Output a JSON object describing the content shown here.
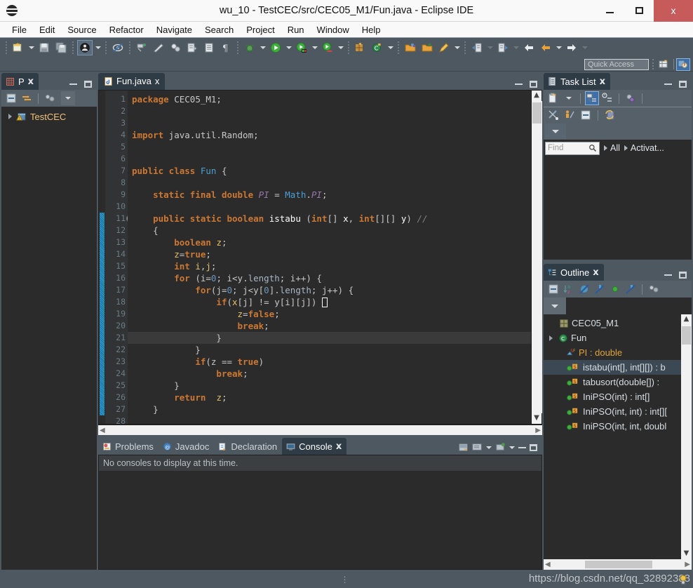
{
  "window": {
    "title": "wu_10 - TestCEC/src/CEC05_M1/Fun.java - Eclipse IDE",
    "minimize_label": "Minimize",
    "maximize_label": "Maximize",
    "close_label": "x"
  },
  "menubar": {
    "items": [
      "File",
      "Edit",
      "Source",
      "Refactor",
      "Navigate",
      "Search",
      "Project",
      "Run",
      "Window",
      "Help"
    ]
  },
  "toolbar": {
    "quick_access_placeholder": "Quick Access",
    "buttons": [
      "new-wizard-icon",
      "new-dropdown-icon",
      "save-icon",
      "save-all-icon",
      "skip-breakpoints-icon",
      "skip-dropdown-icon",
      "no-marker-icon",
      "toggle-mark-occurrences-icon",
      "annotate-icon",
      "link-icon",
      "open-type-icon",
      "open-task-icon",
      "pilcrow-icon",
      "debug-icon",
      "debug-dropdown-icon",
      "run-icon",
      "run-dropdown-icon",
      "run-as-icon",
      "run-as-dropdown-icon",
      "coverage-icon",
      "coverage-dropdown-icon",
      "new-java-project-icon",
      "new-class-icon",
      "new-class-dropdown-icon",
      "open-folder-icon",
      "open-folder2-icon",
      "edit-icon",
      "edit-dropdown-icon",
      "prev-annotation-icon",
      "prev-annotation-dropdown-icon",
      "next-annotation-icon",
      "next-annotation-dropdown-icon",
      "back-icon",
      "back-dropdown-icon",
      "forward-icon",
      "forward-dropdown-icon"
    ],
    "perspective_new_icon": "open-perspective-icon",
    "perspective_active_icon": "java-perspective-icon"
  },
  "package_explorer": {
    "tab_label": "P",
    "tab_icon": "package-explorer-icon",
    "close_label": "x",
    "toolbar": [
      "collapse-all-icon",
      "link-with-editor-icon",
      "view-menu-icon",
      "view-dropdown-icon"
    ],
    "tree": [
      {
        "label": "TestCEC",
        "icon": "java-project-warning-icon",
        "expandable": true
      }
    ]
  },
  "editor": {
    "tab_label": "Fun.java",
    "tab_icon": "java-file-icon",
    "close_label": "x",
    "current_line": 21,
    "fold_marker_line": 11,
    "change_bar_from": 11,
    "change_bar_to": 27,
    "lines": [
      {
        "n": 1,
        "tokens": [
          {
            "t": "package",
            "c": "kw"
          },
          {
            "t": " CEC05_M1;",
            "c": "plain"
          }
        ]
      },
      {
        "n": 2,
        "tokens": []
      },
      {
        "n": 3,
        "tokens": []
      },
      {
        "n": 4,
        "tokens": [
          {
            "t": "import",
            "c": "kw"
          },
          {
            "t": " java.util.Random;",
            "c": "plain"
          }
        ]
      },
      {
        "n": 5,
        "tokens": []
      },
      {
        "n": 6,
        "tokens": []
      },
      {
        "n": 7,
        "tokens": [
          {
            "t": "public class ",
            "c": "kw"
          },
          {
            "t": "Fun",
            "c": "typ"
          },
          {
            "t": " {",
            "c": "plain"
          }
        ]
      },
      {
        "n": 8,
        "tokens": []
      },
      {
        "n": 9,
        "tokens": [
          {
            "t": "    ",
            "c": "plain"
          },
          {
            "t": "static final double ",
            "c": "kw"
          },
          {
            "t": "PI",
            "c": "stat"
          },
          {
            "t": " = ",
            "c": "plain"
          },
          {
            "t": "Math",
            "c": "typ"
          },
          {
            "t": ".",
            "c": "plain"
          },
          {
            "t": "PI",
            "c": "stat"
          },
          {
            "t": ";",
            "c": "plain"
          }
        ]
      },
      {
        "n": 10,
        "tokens": []
      },
      {
        "n": 11,
        "tokens": [
          {
            "t": "    ",
            "c": "plain"
          },
          {
            "t": "public static boolean ",
            "c": "kw"
          },
          {
            "t": "istabu ",
            "c": "meth"
          },
          {
            "t": "(",
            "c": "plain"
          },
          {
            "t": "int",
            "c": "kw"
          },
          {
            "t": "[] ",
            "c": "plain"
          },
          {
            "t": "x",
            "c": "meth"
          },
          {
            "t": ", ",
            "c": "plain"
          },
          {
            "t": "int",
            "c": "kw"
          },
          {
            "t": "[][] ",
            "c": "plain"
          },
          {
            "t": "y",
            "c": "meth"
          },
          {
            "t": ") ",
            "c": "plain"
          },
          {
            "t": "//",
            "c": "cmt"
          }
        ]
      },
      {
        "n": 12,
        "tokens": [
          {
            "t": "    {",
            "c": "plain"
          }
        ]
      },
      {
        "n": 13,
        "tokens": [
          {
            "t": "        ",
            "c": "plain"
          },
          {
            "t": "boolean ",
            "c": "kw"
          },
          {
            "t": "z",
            "c": "var"
          },
          {
            "t": ";",
            "c": "plain"
          }
        ]
      },
      {
        "n": 14,
        "tokens": [
          {
            "t": "        ",
            "c": "plain"
          },
          {
            "t": "z",
            "c": "var"
          },
          {
            "t": "=",
            "c": "plain"
          },
          {
            "t": "true",
            "c": "kw"
          },
          {
            "t": ";",
            "c": "plain"
          }
        ]
      },
      {
        "n": 15,
        "tokens": [
          {
            "t": "        ",
            "c": "plain"
          },
          {
            "t": "int ",
            "c": "kw"
          },
          {
            "t": "i",
            "c": "var"
          },
          {
            "t": ",",
            "c": "plain"
          },
          {
            "t": "j",
            "c": "var"
          },
          {
            "t": ";",
            "c": "plain"
          }
        ]
      },
      {
        "n": 16,
        "tokens": [
          {
            "t": "        ",
            "c": "plain"
          },
          {
            "t": "for",
            "c": "kw"
          },
          {
            "t": " (i=",
            "c": "plain"
          },
          {
            "t": "0",
            "c": "num"
          },
          {
            "t": "; i<y.",
            "c": "plain"
          },
          {
            "t": "length",
            "c": "fld"
          },
          {
            "t": "; i++) {",
            "c": "plain"
          }
        ]
      },
      {
        "n": 17,
        "tokens": [
          {
            "t": "            ",
            "c": "plain"
          },
          {
            "t": "for",
            "c": "kw"
          },
          {
            "t": "(j=",
            "c": "plain"
          },
          {
            "t": "0",
            "c": "num"
          },
          {
            "t": "; j<y[",
            "c": "plain"
          },
          {
            "t": "0",
            "c": "num"
          },
          {
            "t": "].",
            "c": "plain"
          },
          {
            "t": "length",
            "c": "fld"
          },
          {
            "t": "; j++) {",
            "c": "plain"
          }
        ]
      },
      {
        "n": 18,
        "tokens": [
          {
            "t": "                ",
            "c": "plain"
          },
          {
            "t": "if",
            "c": "kw"
          },
          {
            "t": "(",
            "c": "plain"
          },
          {
            "t": "x",
            "c": "var"
          },
          {
            "t": "[j] != y[i][j]) ",
            "c": "plain"
          }
        ],
        "caret_after": true
      },
      {
        "n": 19,
        "tokens": [
          {
            "t": "                    ",
            "c": "plain"
          },
          {
            "t": "z",
            "c": "var"
          },
          {
            "t": "=",
            "c": "plain"
          },
          {
            "t": "false",
            "c": "kw"
          },
          {
            "t": ";",
            "c": "plain"
          }
        ]
      },
      {
        "n": 20,
        "tokens": [
          {
            "t": "                    ",
            "c": "plain"
          },
          {
            "t": "break",
            "c": "kw"
          },
          {
            "t": ";",
            "c": "plain"
          }
        ]
      },
      {
        "n": 21,
        "tokens": [
          {
            "t": "                }",
            "c": "plain"
          }
        ]
      },
      {
        "n": 22,
        "tokens": [
          {
            "t": "            }",
            "c": "plain"
          }
        ]
      },
      {
        "n": 23,
        "tokens": [
          {
            "t": "            ",
            "c": "plain"
          },
          {
            "t": "if",
            "c": "kw"
          },
          {
            "t": "(z == ",
            "c": "plain"
          },
          {
            "t": "true",
            "c": "kw"
          },
          {
            "t": ")",
            "c": "plain"
          }
        ]
      },
      {
        "n": 24,
        "tokens": [
          {
            "t": "                ",
            "c": "plain"
          },
          {
            "t": "break",
            "c": "kw"
          },
          {
            "t": ";",
            "c": "plain"
          }
        ]
      },
      {
        "n": 25,
        "tokens": [
          {
            "t": "        }",
            "c": "plain"
          }
        ]
      },
      {
        "n": 26,
        "tokens": [
          {
            "t": "        ",
            "c": "plain"
          },
          {
            "t": "return",
            "c": "kw"
          },
          {
            "t": "  ",
            "c": "plain"
          },
          {
            "t": "z",
            "c": "var"
          },
          {
            "t": ";",
            "c": "plain"
          }
        ]
      },
      {
        "n": 27,
        "tokens": [
          {
            "t": "    }",
            "c": "plain"
          }
        ]
      },
      {
        "n": 28,
        "tokens": []
      }
    ]
  },
  "bottom_panel": {
    "tabs": [
      {
        "label": "Problems",
        "icon": "problems-icon",
        "active": false
      },
      {
        "label": "Javadoc",
        "icon": "javadoc-icon",
        "active": false
      },
      {
        "label": "Declaration",
        "icon": "declaration-icon",
        "active": false
      },
      {
        "label": "Console",
        "icon": "console-icon",
        "active": true
      }
    ],
    "close_label": "x",
    "console_message": "No consoles to display at this time."
  },
  "task_list": {
    "tab_label": "Task List",
    "tab_icon": "task-list-icon",
    "close_label": "x",
    "toolbar_row1": [
      "new-task-icon",
      "new-task-dropdown-icon",
      "categorized-icon",
      "scheduled-icon",
      "synchronize-icon"
    ],
    "toolbar_row2": [
      "focus-on-workweek-icon",
      "show-all-icon",
      "collapse-all-icon",
      "restore-icon"
    ],
    "view_menu_icon": "view-menu-icon",
    "find_placeholder": "Find",
    "find_value": "",
    "search_icon": "search-icon",
    "filters": [
      "All",
      "Activat..."
    ]
  },
  "outline": {
    "tab_label": "Outline",
    "tab_icon": "outline-icon",
    "close_label": "x",
    "toolbar": [
      "collapse-all-icon",
      "sort-icon",
      "hide-fields-icon",
      "hide-static-icon",
      "hide-nonpublic-icon",
      "hide-local-icon",
      "link-icon"
    ],
    "view_menu_icon": "view-menu-icon",
    "items": [
      {
        "label": "CEC05_M1",
        "icon": "package-icon",
        "indent": 1,
        "selected": false
      },
      {
        "label": "Fun",
        "icon": "class-icon",
        "indent": 1,
        "selected": false,
        "expander": true
      },
      {
        "label": "PI : double",
        "icon": "static-field-icon",
        "indent": 2,
        "selected": false,
        "type_color": true
      },
      {
        "label": "istabu(int[], int[][]) : b",
        "icon": "public-method-icon",
        "indent": 2,
        "selected": true
      },
      {
        "label": "tabusort(double[]) :",
        "icon": "public-method-icon",
        "indent": 2,
        "selected": false
      },
      {
        "label": "IniPSO(int) : int[]",
        "icon": "public-method-icon",
        "indent": 2,
        "selected": false
      },
      {
        "label": "IniPSO(int, int) : int[][",
        "icon": "public-method-icon",
        "indent": 2,
        "selected": false
      },
      {
        "label": "IniPSO(int, int, doubl",
        "icon": "public-method-icon",
        "indent": 2,
        "selected": false
      }
    ]
  },
  "watermark": {
    "text": "https://blog.csdn.net/qq_32892388"
  },
  "colors": {
    "chrome": "#4e5861",
    "editor_bg": "#2b2b2b",
    "gutter_bg": "#313335",
    "tab_active": "#2f3b45",
    "accent_blue": "#3f6fa8",
    "keyword": "#cc7832",
    "type": "#4a9fd4",
    "string": "#6a8759",
    "number": "#6897bb",
    "close_red": "#c75b5b"
  }
}
